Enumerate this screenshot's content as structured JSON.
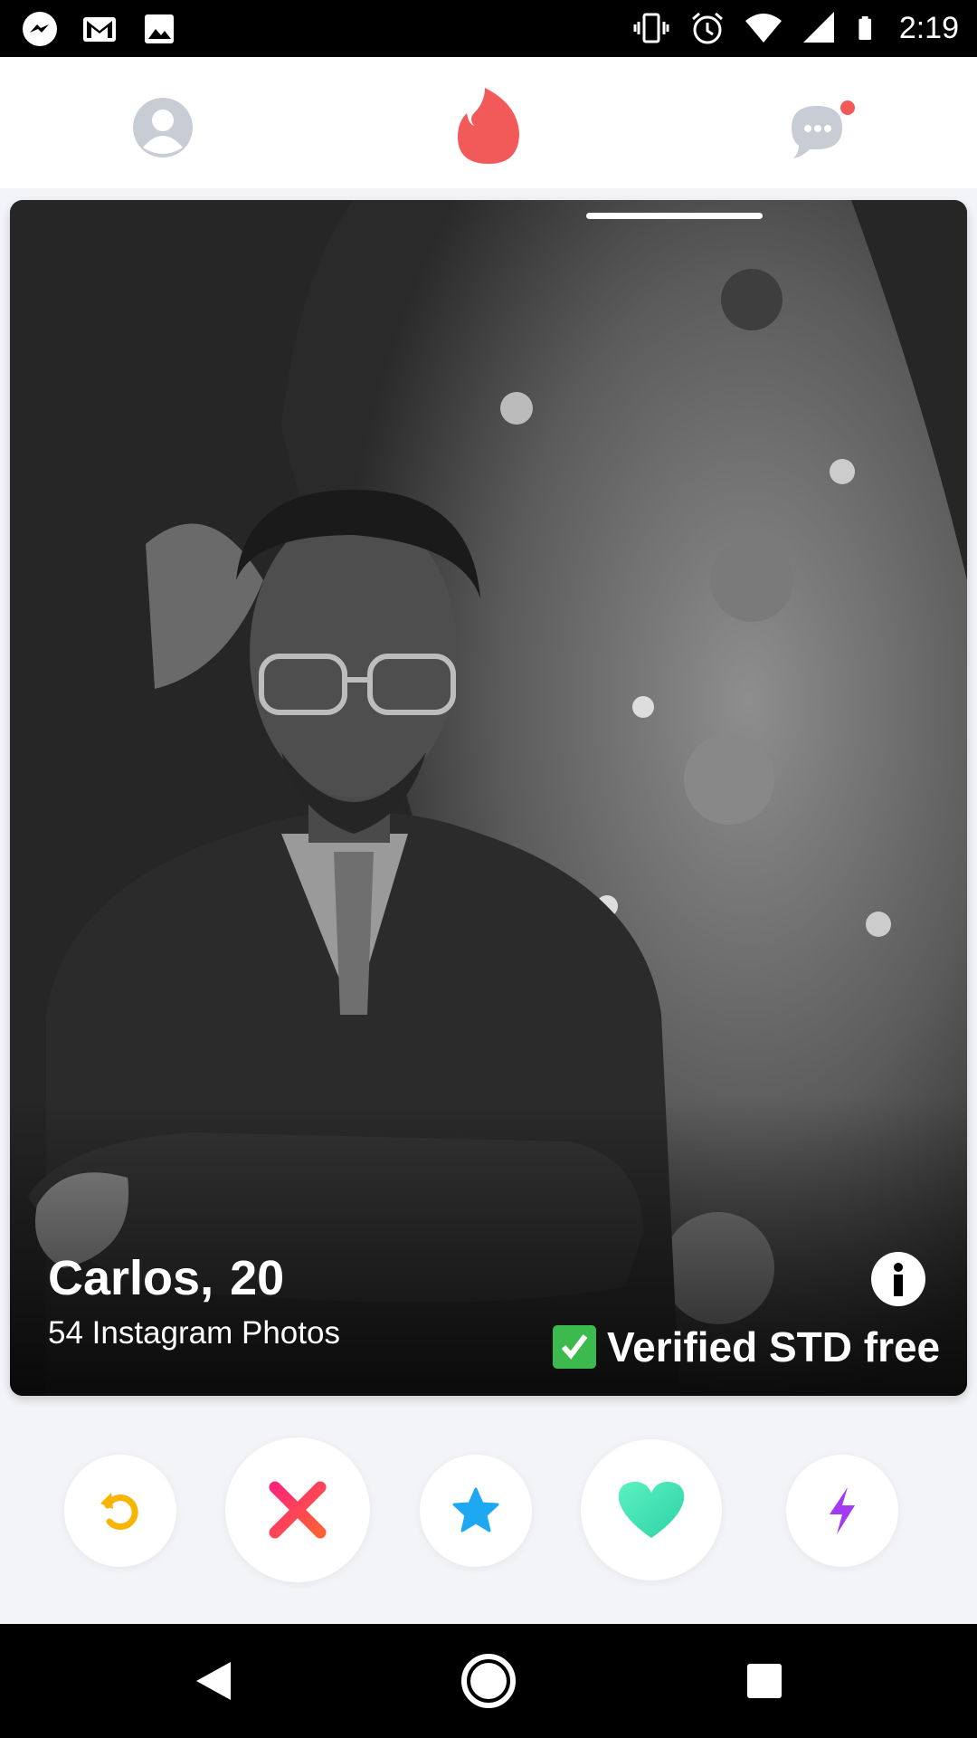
{
  "status_bar": {
    "time": "2:19",
    "left_icons": [
      "messenger-icon",
      "gmail-icon",
      "image-icon"
    ],
    "right_icons": [
      "vibrate-icon",
      "alarm-icon",
      "wifi-icon",
      "signal-icon",
      "battery-icon"
    ]
  },
  "top_bar": {
    "icons": [
      "profile-icon",
      "flame-icon",
      "messages-icon"
    ],
    "messages_unread_dot": true,
    "accent_color": "#f25a5a"
  },
  "card": {
    "name": "Carlos,",
    "age": "20",
    "subtitle": "54 Instagram Photos",
    "verified_mark": "✅",
    "verified_text": "Verified STD free",
    "photo_index": 2,
    "photo_count": 3
  },
  "actions": [
    {
      "name": "rewind",
      "icon": "rewind-icon",
      "color": "#f7b500"
    },
    {
      "name": "nope",
      "icon": "close-icon",
      "color": "#fd5068"
    },
    {
      "name": "super-like",
      "icon": "star-icon",
      "color": "#1ea8f2"
    },
    {
      "name": "like",
      "icon": "heart-icon",
      "color": "#3be0b3"
    },
    {
      "name": "boost",
      "icon": "lightning-icon",
      "color": "#a239f5"
    }
  ],
  "nav_bar": {
    "buttons": [
      "back-icon",
      "home-icon",
      "recents-icon"
    ]
  }
}
